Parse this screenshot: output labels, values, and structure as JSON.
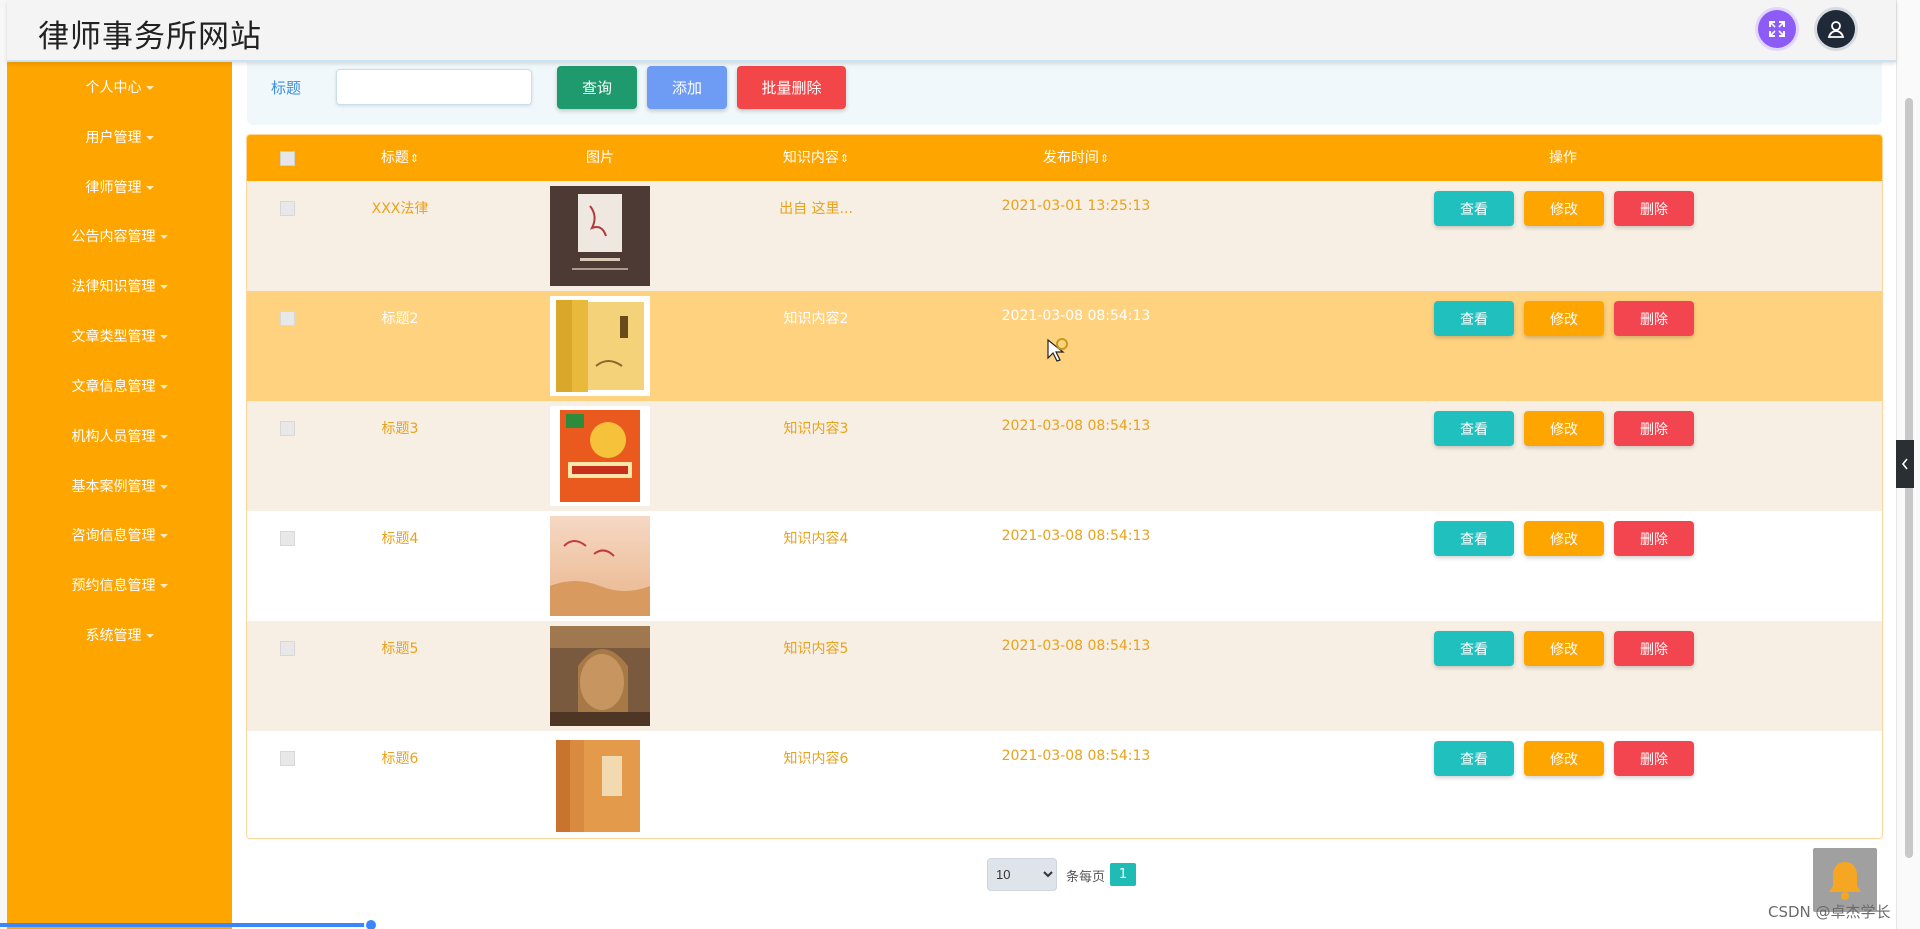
{
  "header": {
    "title": "律师事务所网站",
    "fullscreen_icon": "expand-icon",
    "user_icon": "user-icon",
    "accent": "#8d5cf6"
  },
  "sidebar": {
    "bg": "#ffa500",
    "items": [
      {
        "label": "个人中心"
      },
      {
        "label": "用户管理"
      },
      {
        "label": "律师管理"
      },
      {
        "label": "公告内容管理"
      },
      {
        "label": "法律知识管理"
      },
      {
        "label": "文章类型管理"
      },
      {
        "label": "文章信息管理"
      },
      {
        "label": "机构人员管理"
      },
      {
        "label": "基本案例管理"
      },
      {
        "label": "咨询信息管理"
      },
      {
        "label": "预约信息管理"
      },
      {
        "label": "系统管理"
      }
    ]
  },
  "search": {
    "label": "标题",
    "value": "",
    "placeholder": ""
  },
  "toolbar": {
    "query_label": "查询",
    "add_label": "添加",
    "batch_delete_label": "批量删除"
  },
  "table": {
    "columns": {
      "title": "标题",
      "image": "图片",
      "content": "知识内容",
      "time": "发布时间",
      "actions": "操作",
      "sort_mark": "⇕"
    },
    "rows": [
      {
        "title": "XXX法律",
        "content": "出自 这里...",
        "time": "2021-03-01 13:25:13",
        "image": "book-cover-1"
      },
      {
        "title": "标题2",
        "content": "知识内容2",
        "time": "2021-03-08 08:54:13",
        "image": "book-cover-2"
      },
      {
        "title": "标题3",
        "content": "知识内容3",
        "time": "2021-03-08 08:54:13",
        "image": "book-cover-3"
      },
      {
        "title": "标题4",
        "content": "知识内容4",
        "time": "2021-03-08 08:54:13",
        "image": "book-cover-4"
      },
      {
        "title": "标题5",
        "content": "知识内容5",
        "time": "2021-03-08 08:54:13",
        "image": "magazine-cover"
      },
      {
        "title": "标题6",
        "content": "知识内容6",
        "time": "2021-03-08 08:54:13",
        "image": "book-cover-6"
      }
    ],
    "actions": {
      "view": "查看",
      "edit": "修改",
      "delete": "删除"
    },
    "colors": {
      "header": "#ffa500",
      "row_beige": "#f7efe3",
      "row_hover": "#ffd27f",
      "text": "#e9a21c"
    }
  },
  "pagination": {
    "page_size": "10",
    "page_size_options": [
      "10"
    ],
    "per_page_label": "条每页",
    "current_page": "1"
  },
  "watermark": "CSDN @卓杰学长"
}
